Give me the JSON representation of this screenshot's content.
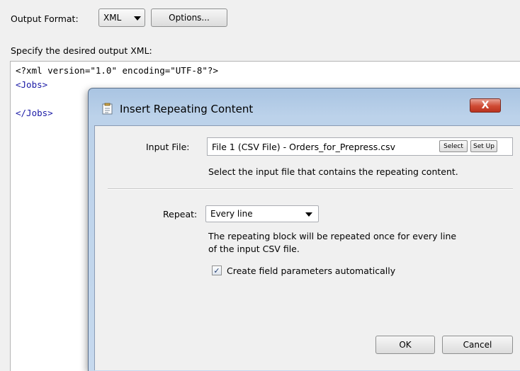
{
  "toolbar": {
    "output_format_label": "Output Format:",
    "output_format_value": "XML",
    "options_button": "Options..."
  },
  "editor": {
    "label": "Specify the desired output XML:",
    "lines": [
      "<?xml version=\"1.0\" encoding=\"UTF-8\"?>",
      "<Jobs>",
      "</Jobs>"
    ]
  },
  "dialog": {
    "title": "Insert Repeating Content",
    "close_label": "X",
    "input_file_label": "Input File:",
    "input_file_value": "File 1 (CSV File) - Orders_for_Prepress.csv",
    "select_button": "Select",
    "setup_button": "Set Up",
    "input_file_help": "Select the input file that contains the repeating content.",
    "repeat_label": "Repeat:",
    "repeat_value": "Every line",
    "repeat_help_line1": "The repeating block will be repeated once for every line",
    "repeat_help_line2": "of the input CSV file.",
    "checkbox_label": "Create field parameters automatically",
    "checkbox_checked": true,
    "ok_button": "OK",
    "cancel_button": "Cancel"
  },
  "colors": {
    "tag_color": "#1a1aa6",
    "title_bar": "#bcd2ea",
    "close_button": "#cf4a33"
  }
}
